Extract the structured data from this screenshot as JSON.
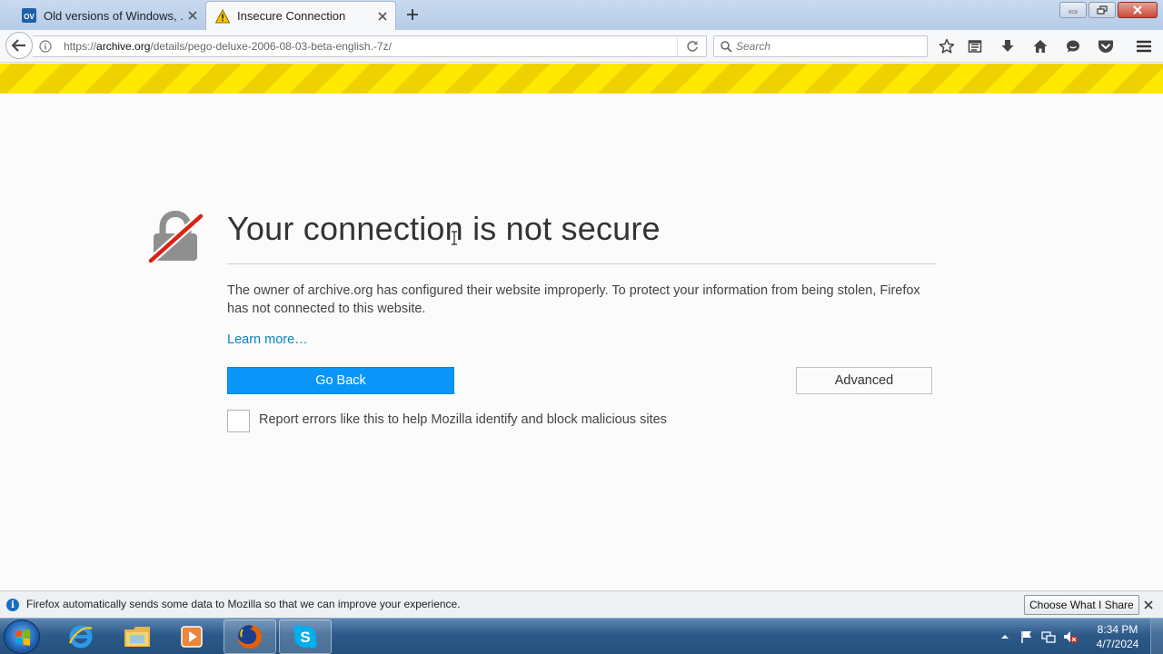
{
  "tabs": [
    {
      "title": "Old versions of Windows, ...",
      "favicon_text": "OV",
      "state": "inactive"
    },
    {
      "title": "Insecure Connection",
      "favicon": "warning-icon",
      "state": "active"
    }
  ],
  "url": {
    "scheme": "https://",
    "host": "archive.org",
    "path": "/details/pego-deluxe-2006-08-03-beta-english.-7z/"
  },
  "search": {
    "placeholder": "Search"
  },
  "error_page": {
    "title": "Your connection is not secure",
    "description": "The owner of archive.org has configured their website improperly. To protect your information from being stolen, Firefox has not connected to this website.",
    "learn_more": "Learn more…",
    "go_back": "Go Back",
    "advanced": "Advanced",
    "report_label": "Report errors like this to help Mozilla identify and block malicious sites",
    "report_checked": false
  },
  "notification": {
    "text": "Firefox automatically sends some data to Mozilla so that we can improve your experience.",
    "button": "Choose What I Share"
  },
  "taskbar": {
    "apps": [
      "internet-explorer",
      "windows-explorer",
      "media-player",
      "firefox",
      "skype"
    ],
    "clock_time": "8:34 PM",
    "clock_date": "4/7/2024"
  },
  "colors": {
    "primary_button": "#0996f8",
    "link": "#0a84c6",
    "warning_stripe": "#ffe900"
  }
}
